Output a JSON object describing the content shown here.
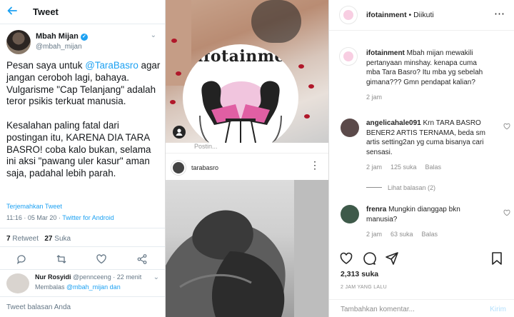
{
  "twitter": {
    "header_title": "Tweet",
    "author_name": "Mbah Mijan",
    "author_handle": "@mbah_mijan",
    "tweet_paragraph_1_prefix": "Pesan saya untuk ",
    "tweet_paragraph_1_mention": "@TaraBasro",
    "tweet_paragraph_1_rest": " agar jangan ceroboh lagi, bahaya. Vulgarisme \"Cap Telanjang\" adalah teror psikis terkuat manusia.",
    "tweet_paragraph_2": "Kesalahan paling fatal dari postingan itu, KARENA DIA TARA BASRO! coba kalo bukan, selama ini aksi \"pawang uler kasur\" aman saja, padahal lebih parah.",
    "translate_label": "Terjemahkan Tweet",
    "timestamp": "11:16 · 05 Mar 20 · ",
    "source": "Twitter for Android",
    "retweets_count": "7",
    "retweets_label": " Retweet",
    "likes_count": "27",
    "likes_label": " Suka",
    "reply_author": "Nur Rosyidi",
    "reply_meta": " @pennceeng · 22 menit",
    "reply_to_prefix": "Membalas ",
    "reply_to_handles": "@mbah_mijan dan",
    "compose_placeholder": "Tweet balasan Anda",
    "accent_color": "#1da1f2"
  },
  "middle": {
    "logo_text": "ifotainment",
    "post_username": "tarabasro",
    "cut_text": "Postin..."
  },
  "instagram": {
    "account": "ifotainment",
    "follow_status": " • Diikuti",
    "caption_user": "ifotainment",
    "caption_text": " Mbah mijan mewakili pertanyaan minshay. kenapa cuma mba Tara Basro? Itu mba yg sebelah gimana??? Gmn pendapat kalian?",
    "caption_time": "2 jam",
    "comments": [
      {
        "user": "angelicahale091",
        "text": " Krn TARA BASRO BENER2 ARTIS TERNAMA, beda sm artis setting2an yg cuma bisanya cari sensasi.",
        "time": "2 jam",
        "likes": "125 suka",
        "reply": "Balas"
      },
      {
        "user": "frenra",
        "text": " Mungkin dianggap bkn manusia?",
        "time": "2 jam",
        "likes": "63 suka",
        "reply": "Balas"
      }
    ],
    "view_replies": "Lihat balasan (2)",
    "likes_total": "2,313 suka",
    "posted_time": "2 JAM YANG LALU",
    "add_comment_placeholder": "Tambahkan komentar...",
    "post_button": "Kirim"
  }
}
